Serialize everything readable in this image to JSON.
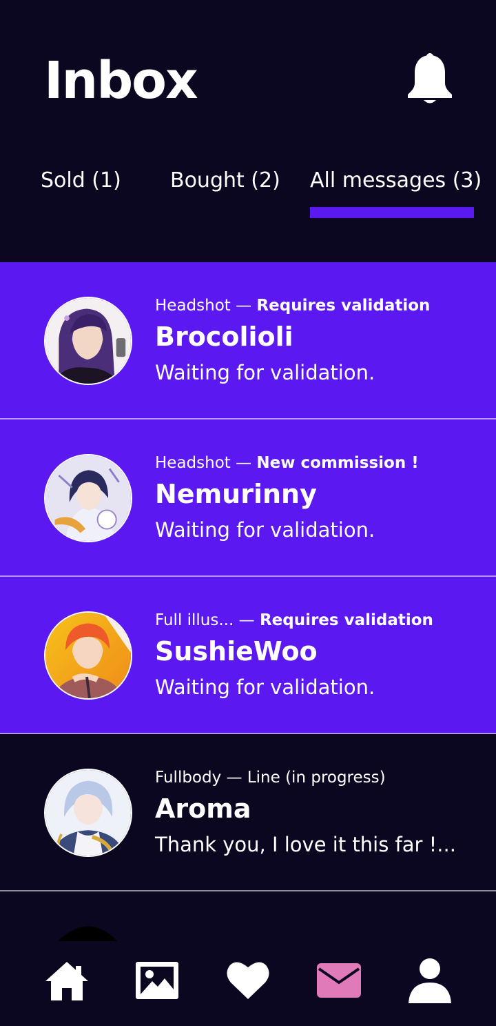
{
  "header": {
    "title": "Inbox",
    "bell_icon": "bell-icon"
  },
  "tabs": [
    {
      "label": "Sold (1)",
      "active": false
    },
    {
      "label": "Bought (2)",
      "active": false
    },
    {
      "label": "All messages (3)",
      "active": true
    }
  ],
  "messages": [
    {
      "type": "Headshot",
      "separator": "—",
      "status": "Requires validation",
      "name": "Brocolioli",
      "preview": "Waiting for validation.",
      "unread": true
    },
    {
      "type": "Headshot",
      "separator": "—",
      "status": "New commission !",
      "name": "Nemurinny",
      "preview": "Waiting for validation.",
      "unread": true
    },
    {
      "type": "Full illus...",
      "separator": "—",
      "status": "Requires validation",
      "name": "SushieWoo",
      "preview": "Waiting for validation.",
      "unread": true
    },
    {
      "type": "Fullbody",
      "separator": "—",
      "status": "Line (in progress)",
      "name": "Aroma",
      "preview": "Thank you, I love it this far !...",
      "unread": false
    }
  ],
  "bottom_nav": [
    {
      "icon": "home-icon",
      "active": false
    },
    {
      "icon": "gallery-icon",
      "active": false
    },
    {
      "icon": "heart-icon",
      "active": false
    },
    {
      "icon": "mail-icon",
      "active": true
    },
    {
      "icon": "profile-icon",
      "active": false
    }
  ],
  "colors": {
    "background": "#0b0720",
    "accent": "#5c18f0",
    "active_nav": "#e07ab8",
    "text": "#ffffff"
  }
}
